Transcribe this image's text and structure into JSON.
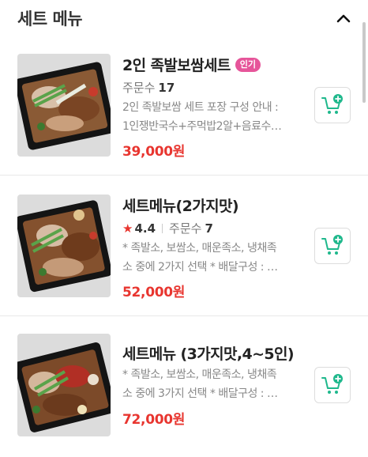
{
  "section": {
    "title": "세트 메뉴",
    "collapse_icon": "chevron-up-icon"
  },
  "items": [
    {
      "name": "2인 족발보쌈세트",
      "badge": "인기",
      "order_label": "주문수",
      "order_count": "17",
      "desc_line1": "2인 족발보쌈 세트 포장 구성 안내 :",
      "desc_line2": "1인쟁반국수+주먹밥2알+음료수…",
      "price": "39,000원",
      "cart_icon": "add-to-cart-icon"
    },
    {
      "name": "세트메뉴(2가지맛)",
      "rating": "4.4",
      "order_label": "주문수",
      "order_count": "7",
      "desc_line1": "* 족발소, 보쌈소, 매운족소, 냉채족",
      "desc_line2": "소 중에 2가지 선택 * 배달구성 : …",
      "price": "52,000원",
      "cart_icon": "add-to-cart-icon"
    },
    {
      "name": "세트메뉴 (3가지맛,4~5인)",
      "desc_line1": "* 족발소, 보쌈소, 매운족소, 냉채족",
      "desc_line2": "소 중에 3가지 선택 * 배달구성 : …",
      "price": "72,000원",
      "cart_icon": "add-to-cart-icon"
    }
  ],
  "colors": {
    "price": "#e8352f",
    "badge": "#e6559a",
    "cart_accent": "#1fb88c"
  }
}
